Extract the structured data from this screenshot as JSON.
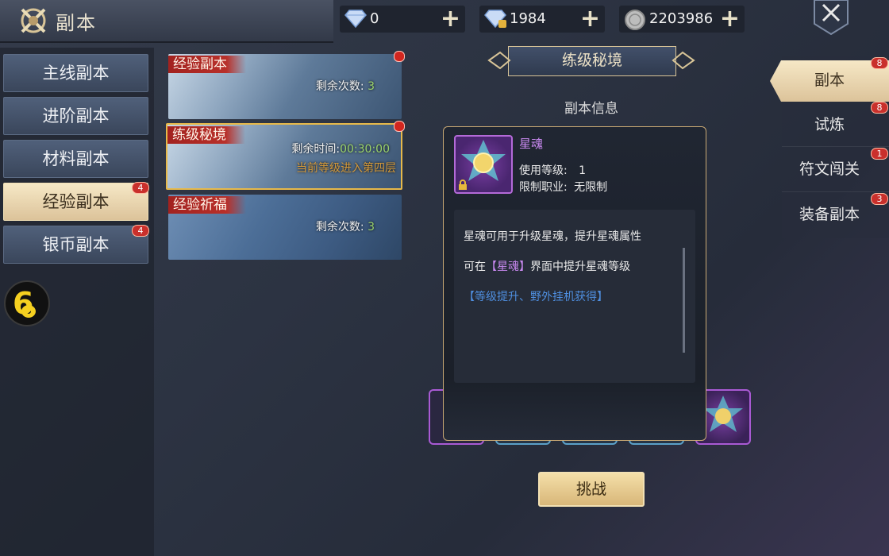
{
  "header": {
    "title": "副本"
  },
  "currencies": [
    {
      "name": "diamond",
      "icon": "diamond-icon",
      "value": "0"
    },
    {
      "name": "bound-diamond",
      "icon": "bound-diamond-icon",
      "value": "1984"
    },
    {
      "name": "silver",
      "icon": "silver-coin-icon",
      "value": "2203986"
    }
  ],
  "plus_symbol": "+",
  "left_nav": [
    {
      "label": "主线副本",
      "badge": ""
    },
    {
      "label": "进阶副本",
      "badge": ""
    },
    {
      "label": "材料副本",
      "badge": ""
    },
    {
      "label": "经验副本",
      "badge": "4",
      "active": true
    },
    {
      "label": "银币副本",
      "badge": "4"
    }
  ],
  "avatar_label": "6",
  "dungeons": [
    {
      "title": "经验副本",
      "info_label": "剩余次数:",
      "info_value": "3"
    },
    {
      "title": "练级秘境",
      "info_label": "剩余时间:",
      "info_value": "00:30:00",
      "note": "当前等级进入第四层"
    },
    {
      "title": "经验祈福",
      "info_label": "剩余次数:",
      "info_value": "3"
    }
  ],
  "center": {
    "title": "练级秘境",
    "subtitle": "副本信息"
  },
  "popup": {
    "item_name": "星魂",
    "level_label": "使用等级:",
    "level_value": "1",
    "class_label": "限制职业:",
    "class_value": "无限制",
    "desc1": "星魂可用于升级星魂，提升星魂属性",
    "desc2_prefix": "可在",
    "desc2_link": "【星魂】",
    "desc2_suffix": "界面中提升星魂等级",
    "desc3": "【等级提升、野外挂机获得】"
  },
  "challenge_label": "挑战",
  "right_tabs": [
    {
      "label": "副本",
      "badge": "8",
      "active": true
    },
    {
      "label": "试炼",
      "badge": "8"
    },
    {
      "label": "符文闯关",
      "badge": "1"
    },
    {
      "label": "装备副本",
      "badge": "3"
    }
  ],
  "colors": {
    "accent_gold": "#dcc39a",
    "badge_red": "#c9302c",
    "item_purple": "#c989f0",
    "link_blue": "#4f8fe0",
    "timer_green": "#9bd36b",
    "note_orange": "#d59a3a"
  }
}
